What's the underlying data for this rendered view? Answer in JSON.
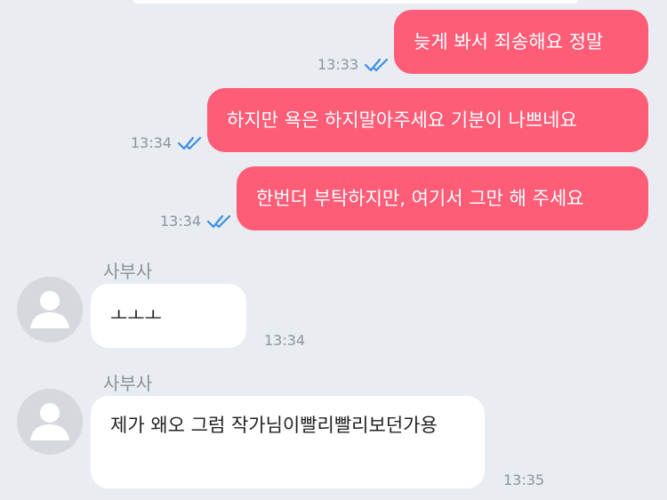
{
  "messages": [
    {
      "text": "늦게 봐서 죄송해요 정말",
      "time": "13:33"
    },
    {
      "text": "하지만 욕은 하지말아주세요 기분이 나쁘네요",
      "time": "13:34"
    },
    {
      "text": "한번더 부탁하지만, 여기서 그만 해 주세요",
      "time": "13:34"
    },
    {
      "sender": "사부사",
      "text": "ㅗㅗㅗ",
      "time": "13:34"
    },
    {
      "sender": "사부사",
      "text": "제가 왜오 그럼 작가님이빨리빨리보던가용",
      "time": "13:35"
    }
  ],
  "colors": {
    "background": "#e9ecf1",
    "outgoing_bubble": "#fe5c77",
    "incoming_bubble": "#ffffff",
    "read_check": "#3a8fe0"
  },
  "icons": [
    "double-check-icon",
    "avatar-icon"
  ]
}
